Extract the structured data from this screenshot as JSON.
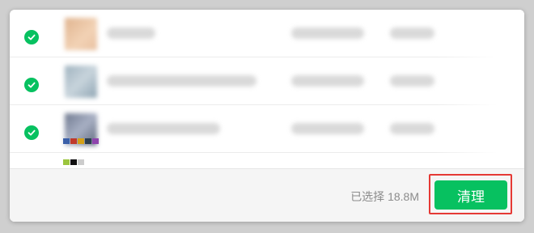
{
  "colors": {
    "accent": "#07c160",
    "highlight_box": "#e53935",
    "footer_bg": "#f5f5f5",
    "secondary_text": "#8c8c8c"
  },
  "list": {
    "items": [
      {
        "checked": true,
        "check_icon": "check-circle-icon",
        "thumbnail": "blurred-image"
      },
      {
        "checked": true,
        "check_icon": "check-circle-icon",
        "thumbnail": "blurred-image"
      },
      {
        "checked": true,
        "check_icon": "check-circle-icon",
        "thumbnail": "blurred-image"
      }
    ]
  },
  "footer": {
    "selected_summary": "已选择 18.8M",
    "clean_button_label": "清理"
  }
}
